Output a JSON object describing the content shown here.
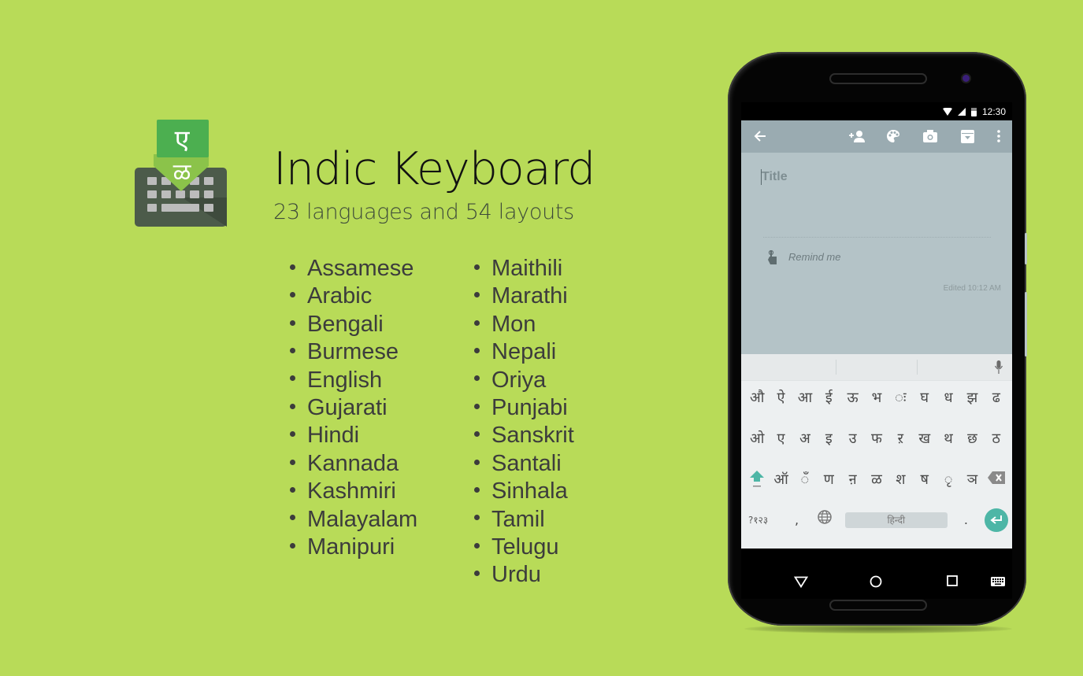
{
  "app": {
    "title": "Indic Keyboard",
    "subtitle": "23 languages and 54 layouts",
    "logo": {
      "glyph_top": "ए",
      "glyph_bottom": "ळ",
      "icon": "keyboard-icon",
      "colors": {
        "green": "#4caf50",
        "light_green": "#8bc34a",
        "keyboard": "#4a5a48",
        "keys": "#bdbdbd"
      }
    }
  },
  "languages": {
    "column1": [
      "Assamese",
      "Arabic",
      "Bengali",
      "Burmese",
      "English",
      "Gujarati",
      "Hindi",
      "Kannada",
      "Kashmiri",
      "Malayalam",
      "Manipuri"
    ],
    "column2": [
      "Maithili",
      "Marathi",
      "Mon",
      "Nepali",
      "Oriya",
      "Punjabi",
      "Sanskrit",
      "Santali",
      "Sinhala",
      "Tamil",
      "Telugu",
      "Urdu"
    ]
  },
  "phone": {
    "status_bar": {
      "time": "12:30",
      "icons": [
        "wifi-icon",
        "signal-icon",
        "battery-icon"
      ]
    },
    "toolbar": {
      "icons": [
        "back-arrow-icon",
        "add-person-icon",
        "palette-icon",
        "camera-icon",
        "archive-icon",
        "more-vert-icon"
      ]
    },
    "note": {
      "title_placeholder": "Title",
      "remind_label": "Remind me",
      "edited_label": "Edited 10:12 AM"
    },
    "keyboard": {
      "row1": [
        "औ",
        "ऐ",
        "आ",
        "ई",
        "ऊ",
        "भ",
        "◌ः",
        "घ",
        "ध",
        "झ",
        "ढ"
      ],
      "row2": [
        "ओ",
        "ए",
        "अ",
        "इ",
        "उ",
        "फ",
        "ऱ",
        "ख",
        "थ",
        "छ",
        "ठ"
      ],
      "row3": [
        "ऑ",
        "◌ँ",
        "ण",
        "ऩ",
        "ळ",
        "श",
        "ष",
        "◌ृ",
        "ञ"
      ],
      "symbols_key": "?१२३",
      "comma_key": ",",
      "period_key": ".",
      "space_label": "हिन्दी",
      "accent": "#4db6a6"
    },
    "nav": {
      "icons": [
        "back-triangle-icon",
        "home-circle-icon",
        "recents-square-icon",
        "keyboard-switch-icon"
      ]
    }
  }
}
